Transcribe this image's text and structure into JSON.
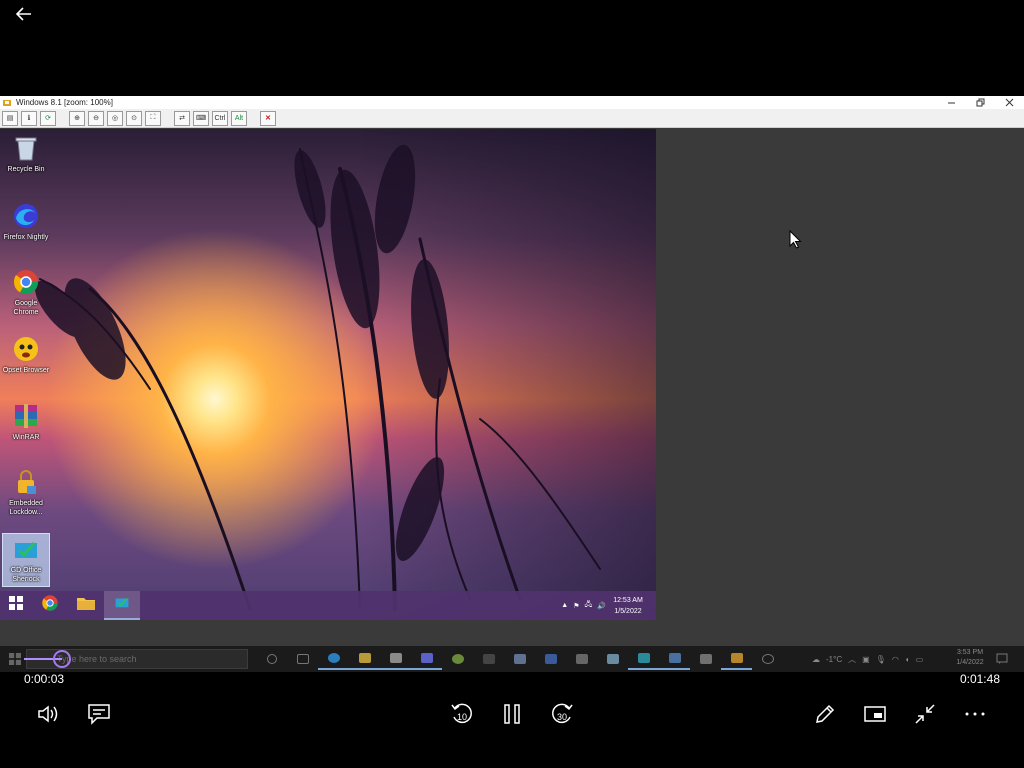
{
  "player": {
    "current_time": "0:00:03",
    "duration": "0:01:48",
    "progress_fraction": 0.028
  },
  "viewer": {
    "title": "Windows 8.1 [zoom: 100%]",
    "toolbar_text_buttons": [
      "Ctrl",
      "Alt"
    ]
  },
  "remote": {
    "desktop_icons": [
      {
        "label": "Recycle Bin"
      },
      {
        "label": "Firefox Nightly"
      },
      {
        "label": "Google Chrome"
      },
      {
        "label": "Opset Browser"
      },
      {
        "label": "WinRAR"
      },
      {
        "label": "Embedded Lockdow..."
      },
      {
        "label": "GD Office Sheriock"
      }
    ],
    "clock_time": "12:53 AM",
    "clock_date": "1/5/2022"
  },
  "host": {
    "search_placeholder": "Type here to search",
    "weather": "-1°C",
    "clock_time": "3:53 PM",
    "clock_date": "1/4/2022"
  },
  "colors": {
    "accent": "#a678f0",
    "remote_taskbar": "#50326e"
  }
}
